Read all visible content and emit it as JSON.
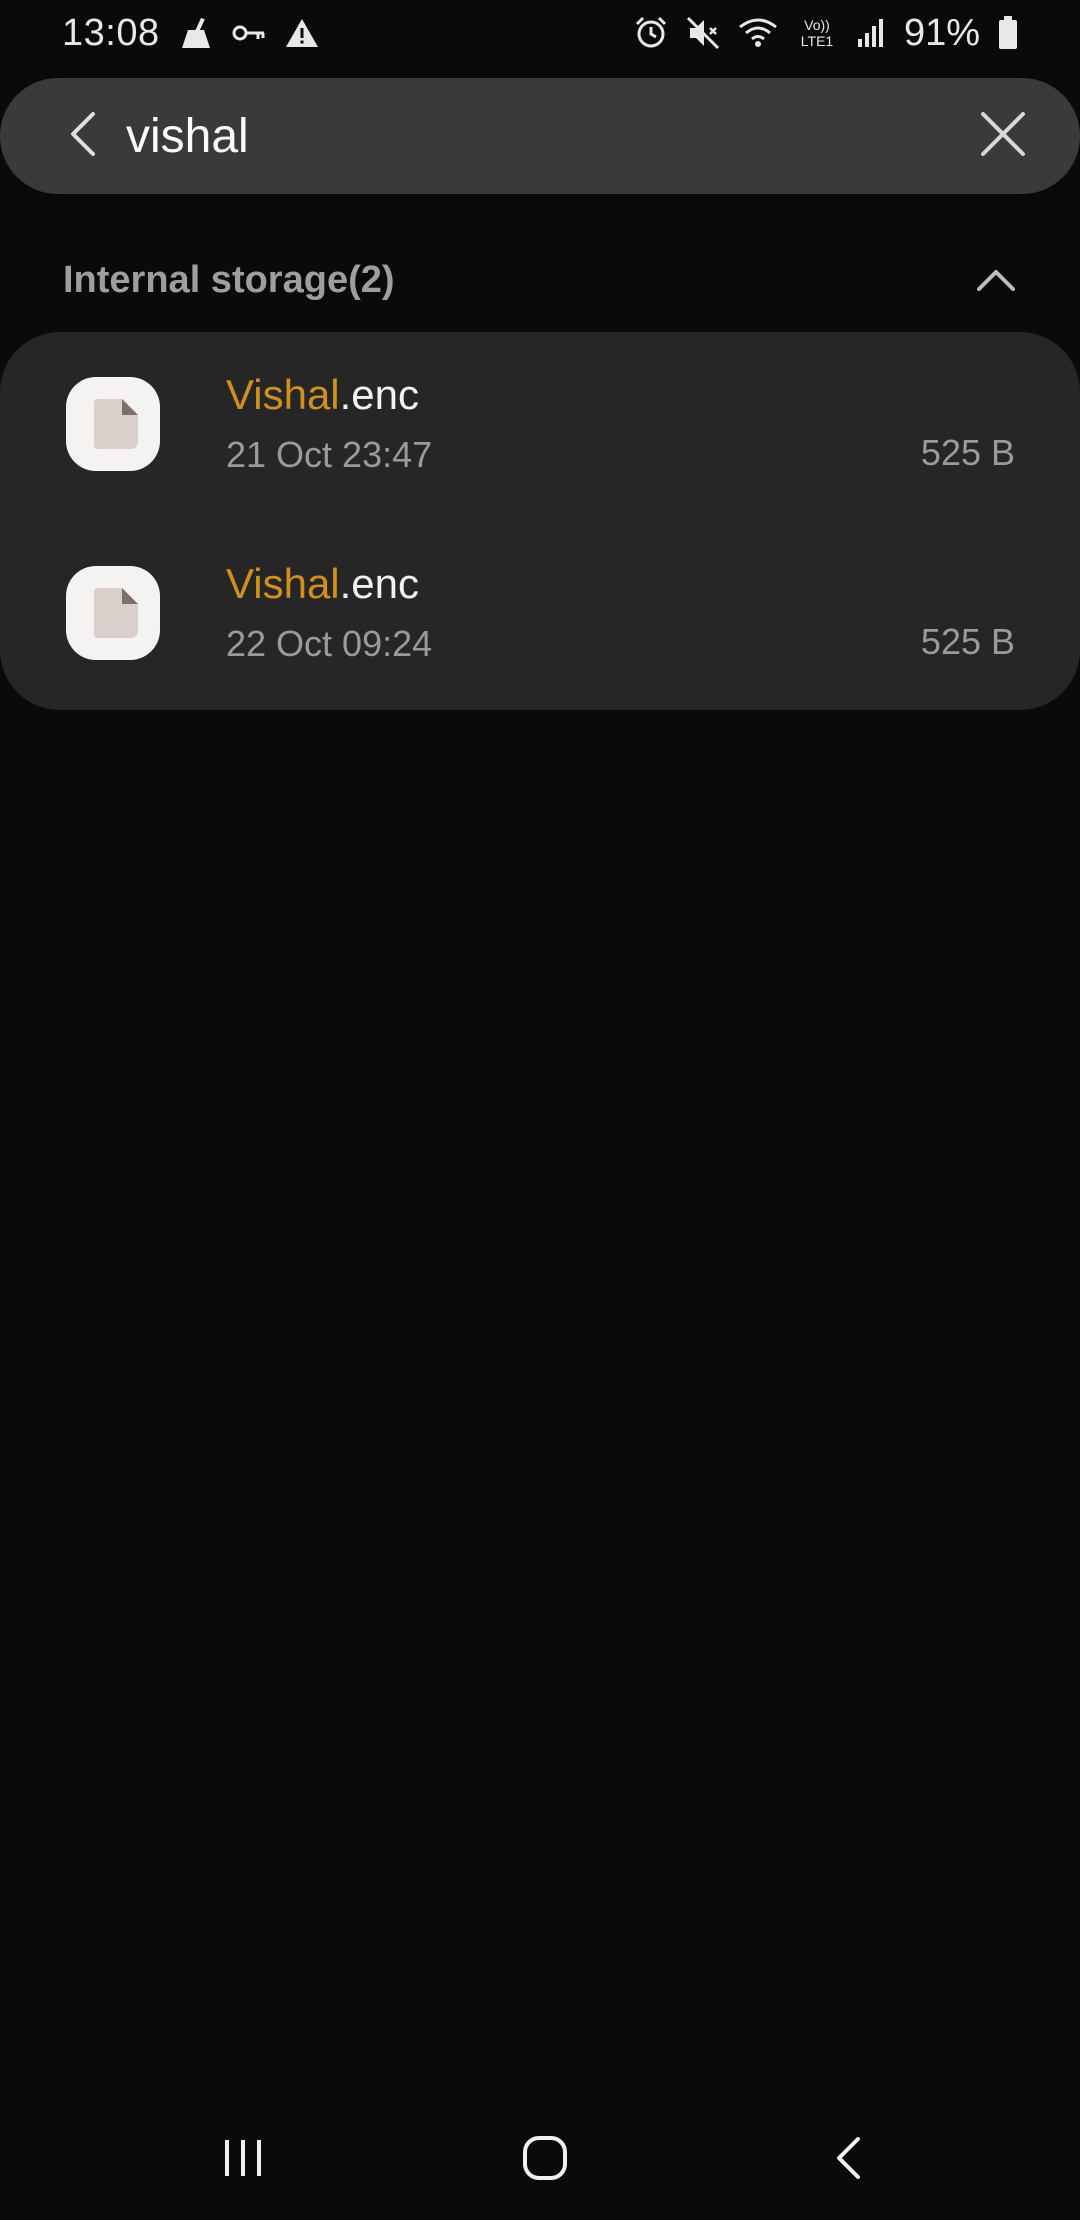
{
  "status_bar": {
    "time": "13:08",
    "battery_percent": "91%",
    "icons_left": [
      "cleaner-icon",
      "key-icon",
      "warning-icon"
    ],
    "icons_right": [
      "alarm-icon",
      "mute-icon",
      "wifi-icon",
      "volte-icon",
      "signal-icon",
      "battery-icon"
    ],
    "volte_label": "Vo)) LTE1"
  },
  "search": {
    "query": "vishal",
    "back_icon": "back-arrow-icon",
    "clear_icon": "close-icon"
  },
  "section": {
    "title": "Internal storage(2)",
    "collapse_icon": "chevron-up-icon"
  },
  "files": [
    {
      "name_highlight": "Vishal",
      "name_rest": ".enc",
      "date": "21 Oct 23:47",
      "size": "525 B",
      "icon": "document-icon"
    },
    {
      "name_highlight": "Vishal",
      "name_rest": ".enc",
      "date": "22 Oct 09:24",
      "size": "525 B",
      "icon": "document-icon"
    }
  ],
  "nav_bar": {
    "recents_icon": "recents-icon",
    "home_icon": "home-icon",
    "back_icon": "nav-back-icon"
  },
  "colors": {
    "background": "#0a0a0a",
    "search_bg": "#3a3a3a",
    "card_bg": "#262626",
    "highlight": "#d08f1f",
    "secondary_text": "#9a9a9a"
  }
}
